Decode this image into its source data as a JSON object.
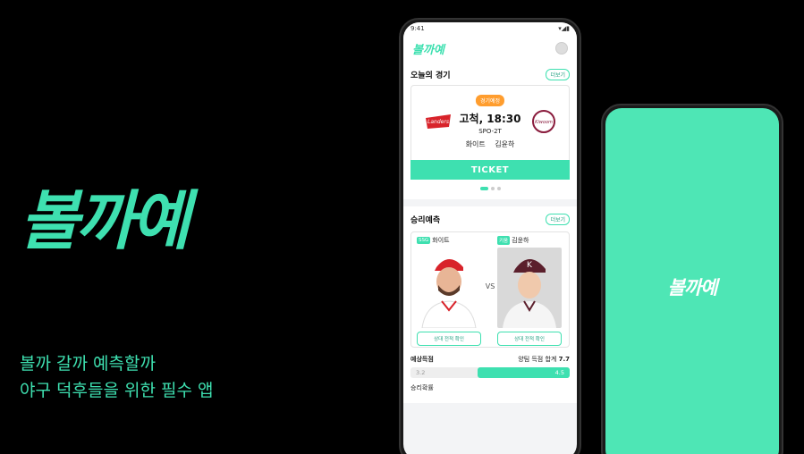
{
  "hero": {
    "logo": "볼까예",
    "tagline_1": "볼까 갈까 예측할까",
    "tagline_2": "야구 덕후들을 위한 필수 앱"
  },
  "status": {
    "time": "9:41",
    "icons": "▾◢▮"
  },
  "app": {
    "logo": "볼까예"
  },
  "today": {
    "title": "오늘의 경기",
    "more": "더보기",
    "badge": "경기예정",
    "time": "고척, 18:30",
    "channel": "SPO-2T",
    "pitcher_home": "화이트",
    "pitcher_away": "김윤하",
    "ticket": "TICKET",
    "home_logo_text": "Landers",
    "away_logo_text": "Kiwoom"
  },
  "predict": {
    "title": "승리예측",
    "more": "더보기",
    "left": {
      "team": "SSG",
      "name": "화이트",
      "button": "상대 전적 확인"
    },
    "right": {
      "team": "키움",
      "name": "김윤하",
      "button": "상대 전적 확인"
    },
    "vs": "VS",
    "score_label": "예상득점",
    "total_label": "양팀 득점 합계",
    "total_value": "7.7",
    "left_score": "3.2",
    "right_score": "4.5",
    "winrate_label": "승리확률"
  },
  "splash": {
    "logo": "볼까예"
  },
  "colors": {
    "accent": "#3ee0b0",
    "badge": "#ff9d2e",
    "background": "#000000"
  }
}
